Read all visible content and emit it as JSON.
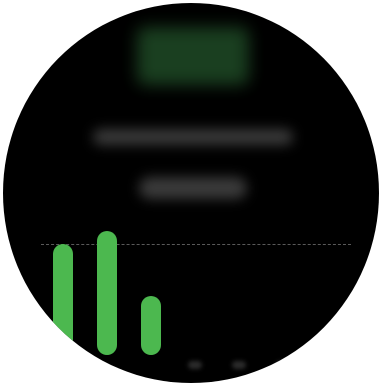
{
  "screen": {
    "background": "#000000",
    "accent": "#4cb84f"
  },
  "header": {
    "value_text": "",
    "caption_text": "",
    "button_label": ""
  },
  "chart_data": {
    "type": "bar",
    "categories": [
      "",
      "",
      "",
      "",
      "",
      ""
    ],
    "values": [
      1.0,
      1.12,
      0.53,
      0,
      0,
      0
    ],
    "goal": 1.0,
    "ylim": [
      0,
      1.12
    ],
    "title": "",
    "xlabel": "",
    "ylabel": "",
    "grid": false,
    "goal_line_style": "dashed"
  }
}
